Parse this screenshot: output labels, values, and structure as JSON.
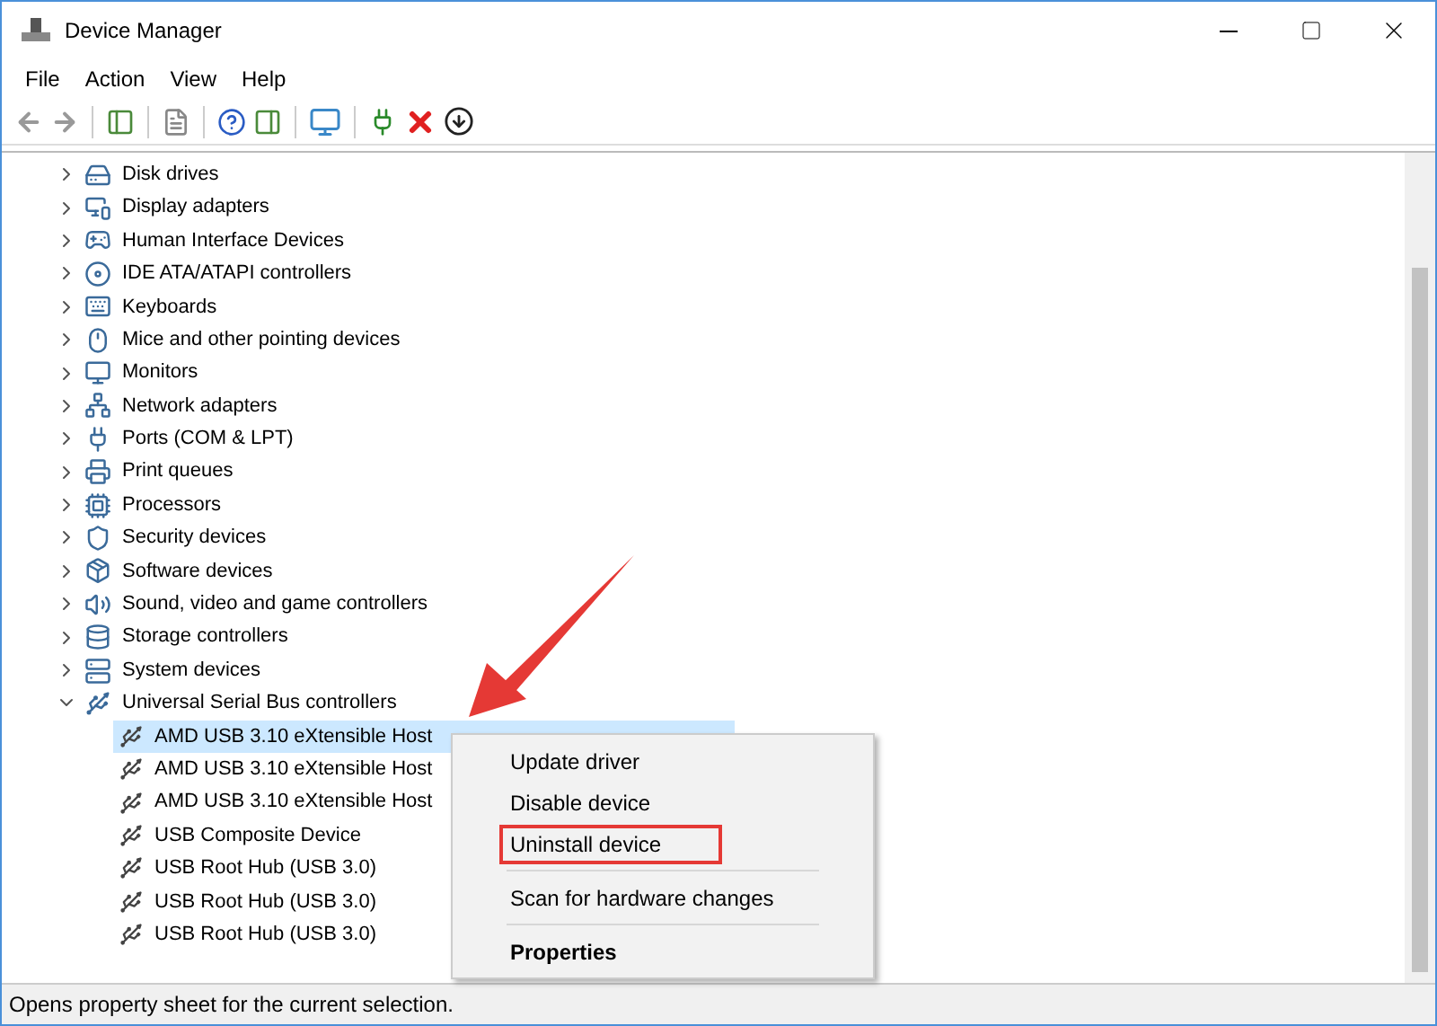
{
  "window": {
    "title": "Device Manager"
  },
  "menu": [
    "File",
    "Action",
    "View",
    "Help"
  ],
  "tree": [
    {
      "label": "Disk drives",
      "expanded": false
    },
    {
      "label": "Display adapters",
      "expanded": false
    },
    {
      "label": "Human Interface Devices",
      "expanded": false
    },
    {
      "label": "IDE ATA/ATAPI controllers",
      "expanded": false
    },
    {
      "label": "Keyboards",
      "expanded": false
    },
    {
      "label": "Mice and other pointing devices",
      "expanded": false
    },
    {
      "label": "Monitors",
      "expanded": false
    },
    {
      "label": "Network adapters",
      "expanded": false
    },
    {
      "label": "Ports (COM & LPT)",
      "expanded": false
    },
    {
      "label": "Print queues",
      "expanded": false
    },
    {
      "label": "Processors",
      "expanded": false
    },
    {
      "label": "Security devices",
      "expanded": false
    },
    {
      "label": "Software devices",
      "expanded": false
    },
    {
      "label": "Sound, video and game controllers",
      "expanded": false
    },
    {
      "label": "Storage controllers",
      "expanded": false
    },
    {
      "label": "System devices",
      "expanded": false
    },
    {
      "label": "Universal Serial Bus controllers",
      "expanded": true,
      "children": [
        {
          "label": "AMD USB 3.10 eXtensible Host",
          "selected": true
        },
        {
          "label": "AMD USB 3.10 eXtensible Host",
          "selected": false
        },
        {
          "label": "AMD USB 3.10 eXtensible Host",
          "selected": false
        },
        {
          "label": "USB Composite Device",
          "selected": false
        },
        {
          "label": "USB Root Hub (USB 3.0)",
          "selected": false
        },
        {
          "label": "USB Root Hub (USB 3.0)",
          "selected": false
        },
        {
          "label": "USB Root Hub (USB 3.0)",
          "selected": false
        }
      ]
    }
  ],
  "context_menu": [
    {
      "label": "Update driver",
      "separator_before": false,
      "default": false,
      "annotated": false
    },
    {
      "label": "Disable device",
      "separator_before": false,
      "default": false,
      "annotated": false
    },
    {
      "label": "Uninstall device",
      "separator_before": false,
      "default": false,
      "annotated": true
    },
    {
      "label": "Scan for hardware changes",
      "separator_before": true,
      "default": false,
      "annotated": false
    },
    {
      "label": "Properties",
      "separator_before": true,
      "default": true,
      "annotated": false
    }
  ],
  "status_bar": "Opens property sheet for the current selection."
}
